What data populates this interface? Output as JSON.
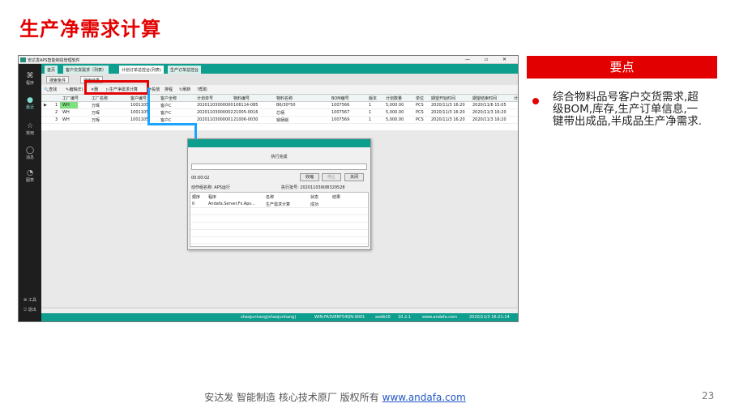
{
  "slide": {
    "title": "生产净需求计算",
    "page_number": "23",
    "footer_text": "安达发  智能制造 核心技术原厂   版权所有",
    "footer_link": "www.andafa.com"
  },
  "panel": {
    "heading": "要点",
    "bullet": "综合物料品号客户交货需求,超级BOM,库存,生产订单信息,一键带出成品,半成品生产净需求."
  },
  "app": {
    "window_title": "安达发APS智能制造管理软件",
    "window_controls": "—  ▫  ✕",
    "sidebar": [
      {
        "icon": "⌘",
        "label": "程序"
      },
      {
        "icon": "●",
        "label": "最近"
      },
      {
        "icon": "☆",
        "label": "常用"
      },
      {
        "icon": "◯",
        "label": "消息"
      },
      {
        "icon": "◔",
        "label": "图表"
      },
      {
        "icon": "⚙",
        "label": "工具"
      },
      {
        "icon": "⎋",
        "label": "退出"
      }
    ],
    "tabs": [
      "首页",
      "客户交货需求（列表）",
      "计划订单总控台(列表)",
      "生产订单总控台"
    ],
    "subtabs": [
      "搜索条件",
      "搜索结果"
    ],
    "toolbar": [
      "查找",
      "编辑(E)",
      "删",
      "生产净需求计算",
      "投放",
      "排程",
      "刷新",
      "帮助"
    ],
    "table": {
      "headers": [
        "工厂编号",
        "工厂名称",
        "客户编号",
        "客户全称",
        "计划单号",
        "物料编号",
        "物料名称",
        "BOM编号",
        "版本",
        "计划数量",
        "单位",
        "期望开始时间",
        "期望结束时间",
        "计"
      ],
      "rows": [
        {
          "idx": "1",
          "c": [
            "WH",
            "万晖",
            "1001105",
            "客户C",
            "20201103000000",
            "106114-085",
            "B6/30*50",
            "1007566",
            "1",
            "5,000.00",
            "PCS",
            "2020/11/3 16:20",
            "2020/11/6 15:05",
            ""
          ]
        },
        {
          "idx": "2",
          "c": [
            "WH",
            "万晖",
            "1001105",
            "客户C",
            "20201103000002",
            "21005-0016",
            "芯柄",
            "1007567",
            "1",
            "5,000.00",
            "PCS",
            "2020/11/3 16:20",
            "2020/11/3 16:20",
            ""
          ]
        },
        {
          "idx": "3",
          "c": [
            "WH",
            "万晖",
            "1001105",
            "客户C",
            "20201103000001",
            "21006-0030",
            "锅柄锅",
            "1007569",
            "1",
            "5,000.00",
            "PCS",
            "2020/11/3 16:20",
            "2020/11/3 16:20",
            ""
          ]
        }
      ]
    },
    "statusbar": {
      "user": "shaojunhang(shaojunhang)",
      "server": "WIN-FA3VERF54QN:9001",
      "db": "axdb10",
      "ip": "10.2.1",
      "site": "www.andafa.com",
      "time": "2020/11/3 16:21:14"
    }
  },
  "dialog": {
    "title": "执行完成",
    "elapsed": "00:00:02",
    "buttons": [
      "收缩",
      "停止",
      "关闭"
    ],
    "action_name": "动作组名称: APS运行",
    "exec_batch": "执行批号: 20201103I6I8I329528",
    "log_headers": [
      "顺序",
      "程序",
      "名称",
      "状态",
      "结果"
    ],
    "log_rows": [
      [
        "0",
        "Andafa.Server.Fs.Aps...",
        "生产需求计算",
        "成功",
        ""
      ]
    ]
  }
}
